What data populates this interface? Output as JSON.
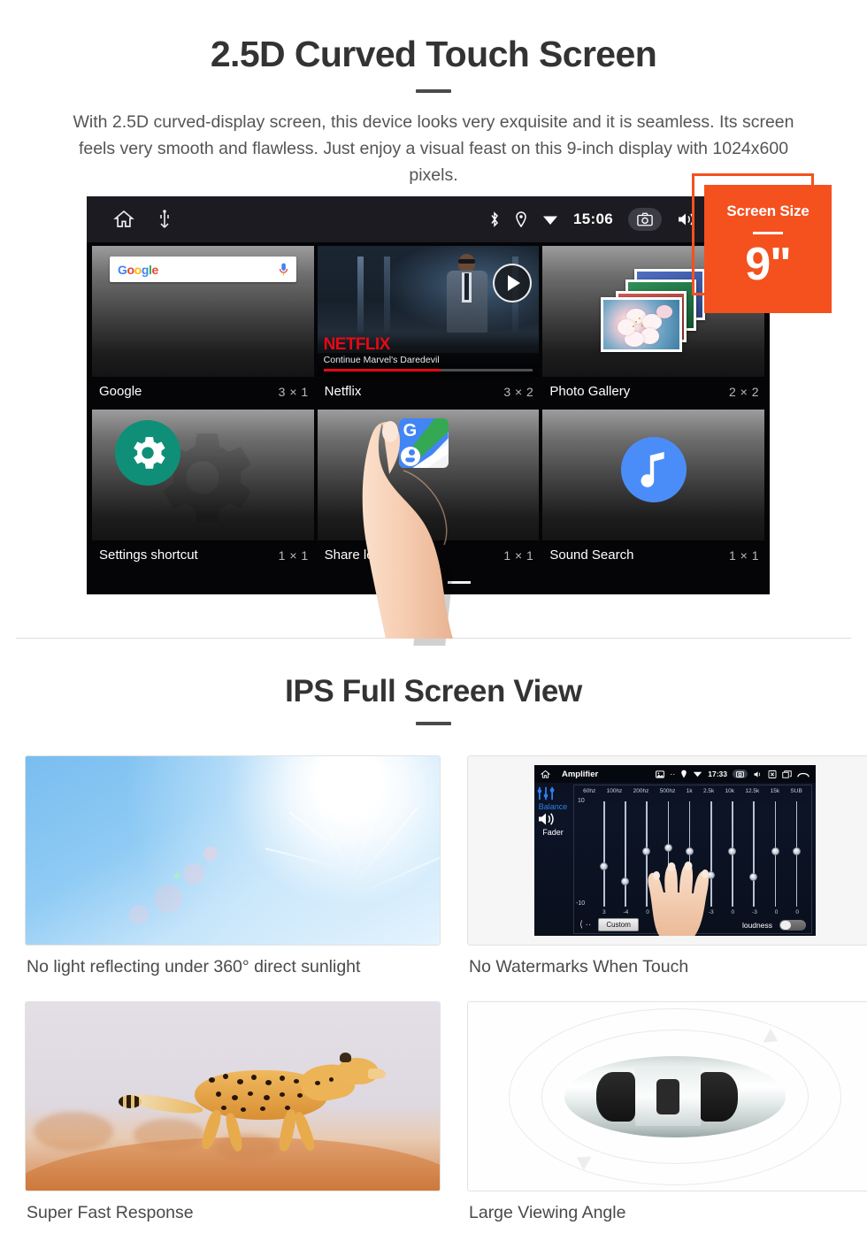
{
  "section_one": {
    "title": "2.5D Curved Touch Screen",
    "description": "With 2.5D curved-display screen, this device looks very exquisite and it is seamless. Its screen feels very smooth and flawless. Just enjoy a visual feast on this 9-inch display with 1024x600 pixels."
  },
  "badge": {
    "label": "Screen Size",
    "value": "9\"",
    "color": "#f4511e"
  },
  "device": {
    "status_bar": {
      "time": "15:06",
      "left_icons": [
        "home-icon",
        "usb-icon"
      ],
      "right_icons": [
        "bluetooth-icon",
        "location-icon",
        "wifi-icon",
        "camera-icon",
        "volume-icon",
        "close-icon",
        "recents-icon"
      ]
    },
    "widgets": [
      {
        "name": "Google",
        "size": "3 × 1",
        "icon": "google-search-widget",
        "search_placeholder": "",
        "logo_letters": [
          "G",
          "o",
          "o",
          "g",
          "l",
          "e"
        ]
      },
      {
        "name": "Netflix",
        "size": "3 × 2",
        "icon": "netflix-widget",
        "brand": "NETFLIX",
        "subtitle": "Continue Marvel's Daredevil"
      },
      {
        "name": "Photo Gallery",
        "size": "2 × 2",
        "icon": "photo-gallery-widget"
      },
      {
        "name": "Settings shortcut",
        "size": "1 × 1",
        "icon": "gear-icon"
      },
      {
        "name": "Share location",
        "size": "1 × 1",
        "icon": "google-maps-icon"
      },
      {
        "name": "Sound Search",
        "size": "1 × 1",
        "icon": "music-note-icon"
      }
    ],
    "page_indicator": {
      "count": 3,
      "active": 3
    }
  },
  "section_two": {
    "title": "IPS Full Screen View",
    "cards": [
      {
        "caption": "No light reflecting under 360° direct sunlight",
        "image": "blue-sky-with-sun"
      },
      {
        "caption": "No Watermarks When Touch",
        "image": "amplifier-equalizer-screen"
      },
      {
        "caption": "Super Fast Response",
        "image": "running-cheetah"
      },
      {
        "caption": "Large Viewing Angle",
        "image": "car-top-view-rotating"
      }
    ]
  },
  "amplifier": {
    "title": "Amplifier",
    "time": "17:33",
    "left_controls": [
      "Balance",
      "Fader"
    ],
    "bands": [
      "60hz",
      "100hz",
      "200hz",
      "500hz",
      "1k",
      "2.5k",
      "10k",
      "12.5k",
      "15k",
      "SUB"
    ],
    "values": [
      "3",
      "-4",
      "0",
      "0",
      "0",
      "-3",
      "0",
      "-3",
      "0",
      "0"
    ],
    "scale_top": "10",
    "scale_zero": "0",
    "scale_bottom": "-10",
    "preset": "Custom",
    "loudness_label": "loudness",
    "loudness_on": false
  }
}
